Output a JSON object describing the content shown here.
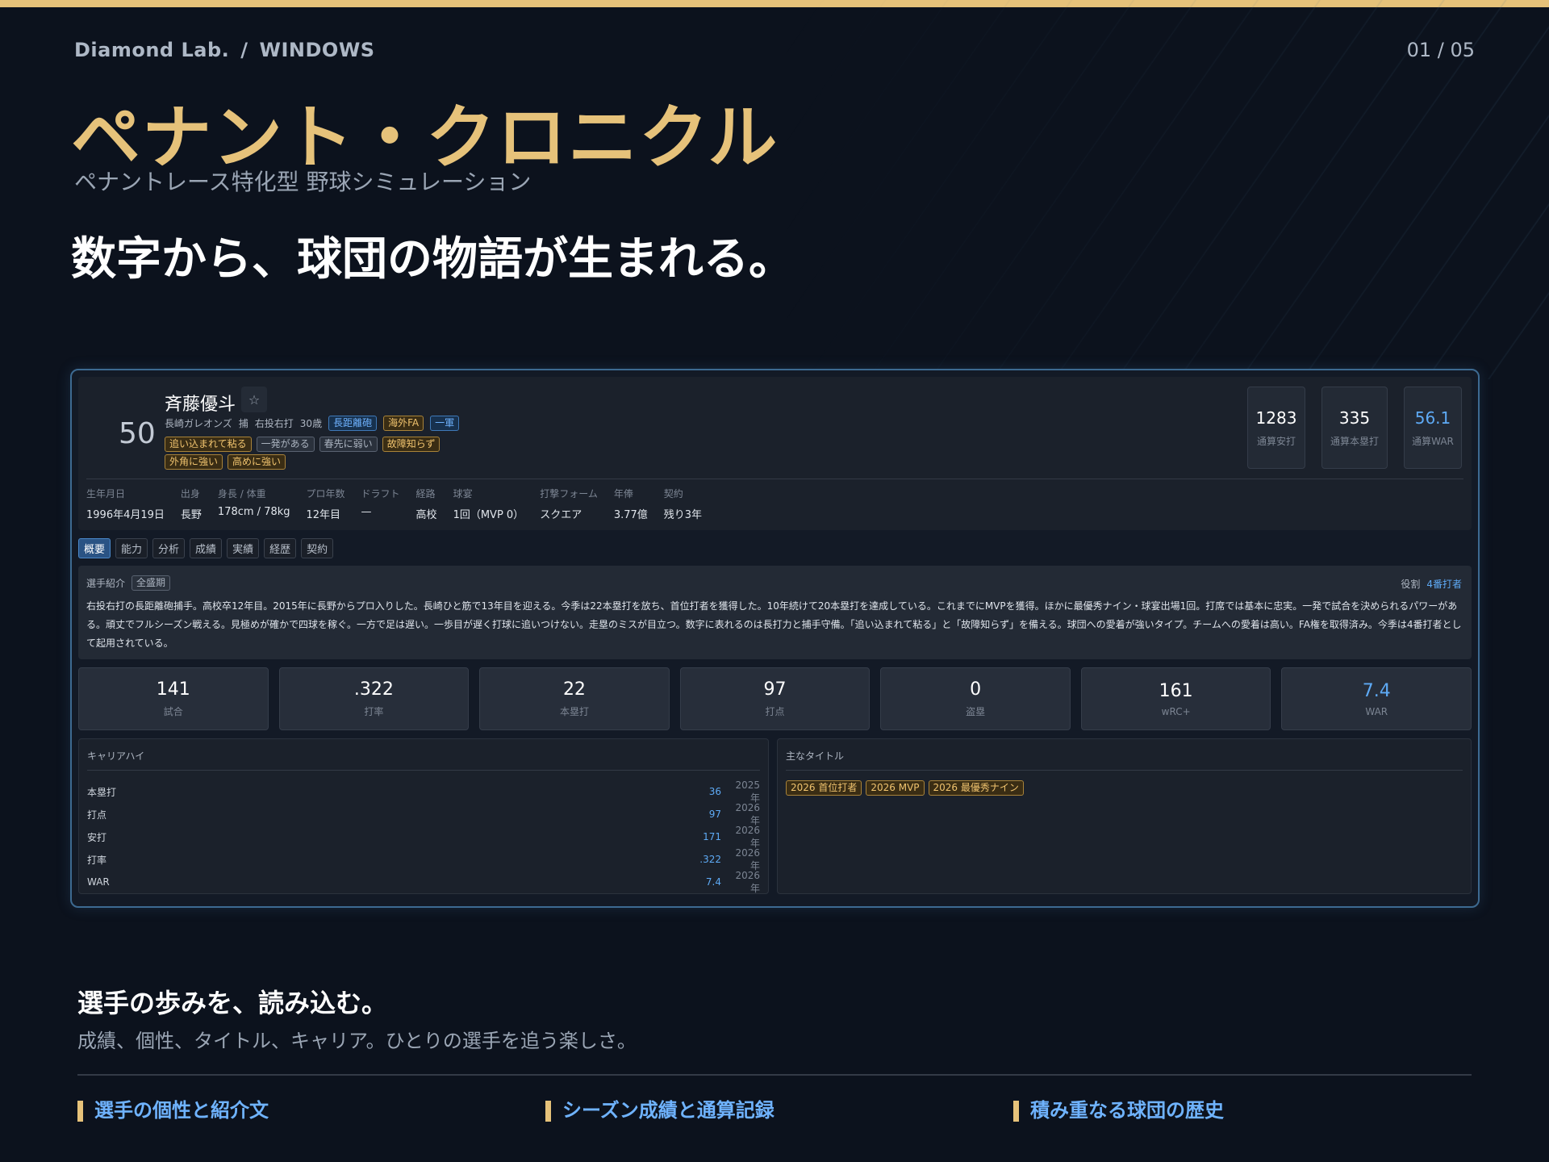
{
  "header": {
    "brand": "Diamond Lab.",
    "separator": "/",
    "section": "WINDOWS",
    "page": "01 / 05"
  },
  "hero": {
    "title": "ペナント・クロニクル",
    "subtitle": "ペナントレース特化型 野球シミュレーション",
    "tagline": "数字から、球団の物語が生まれる。"
  },
  "player": {
    "number": "50",
    "name": "斉藤優斗",
    "fav_icon": "star-outline-icon",
    "team": "長崎ガレオンズ",
    "position": "捕",
    "handed": "右投右打",
    "age": "30歳",
    "badges": [
      "長距離砲",
      "海外FA",
      "一軍"
    ],
    "traits_row1": [
      "追い込まれて粘る",
      "一発がある",
      "春先に弱い",
      "故障知らず"
    ],
    "traits_row2": [
      "外角に強い",
      "高めに強い"
    ],
    "highlights": [
      {
        "value": "1283",
        "label": "通算安打"
      },
      {
        "value": "335",
        "label": "通算本塁打"
      },
      {
        "value": "56.1",
        "label": "通算WAR"
      }
    ],
    "info": [
      {
        "label": "生年月日",
        "value": "1996年4月19日"
      },
      {
        "label": "出身",
        "value": "長野"
      },
      {
        "label": "身長 / 体重",
        "value": "178cm / 78kg"
      },
      {
        "label": "プロ年数",
        "value": "12年目"
      },
      {
        "label": "ドラフト",
        "value": "—"
      },
      {
        "label": "経路",
        "value": "高校"
      },
      {
        "label": "球宴",
        "value": "1回（MVP 0）"
      },
      {
        "label": "打撃フォーム",
        "value": "スクエア"
      },
      {
        "label": "年俸",
        "value": "3.77億"
      },
      {
        "label": "契約",
        "value": "残り3年"
      }
    ]
  },
  "tabs": [
    "概要",
    "能力",
    "分析",
    "成績",
    "実績",
    "経歴",
    "契約"
  ],
  "intro": {
    "label": "選手紹介",
    "period": "全盛期",
    "role_label": "役割",
    "role_value": "4番打者",
    "text": "右投右打の長距離砲捕手。高校卒12年目。2015年に長野からプロ入りした。長崎ひと筋で13年目を迎える。今季は22本塁打を放ち、首位打者を獲得した。10年続けて20本塁打を達成している。これまでにMVPを獲得。ほかに最優秀ナイン・球宴出場1回。打席では基本に忠実。一発で試合を決められるパワーがある。頑丈でフルシーズン戦える。見極めが確かで四球を稼ぐ。一方で足は遅い。一歩目が遅く打球に追いつけない。走塁のミスが目立つ。数字に表れるのは長打力と捕手守備。「追い込まれて粘る」と「故障知らず」を備える。球団への愛着が強いタイプ。チームへの愛着は高い。FA権を取得済み。今季は4番打者として起用されている。"
  },
  "season_stats": [
    {
      "value": "141",
      "label": "試合"
    },
    {
      "value": ".322",
      "label": "打率"
    },
    {
      "value": "22",
      "label": "本塁打"
    },
    {
      "value": "97",
      "label": "打点"
    },
    {
      "value": "0",
      "label": "盗塁"
    },
    {
      "value": "161",
      "label": "wRC+"
    },
    {
      "value": "7.4",
      "label": "WAR"
    }
  ],
  "career_high": {
    "title": "キャリアハイ",
    "rows": [
      {
        "label": "本塁打",
        "value": "36",
        "year": "2025年"
      },
      {
        "label": "打点",
        "value": "97",
        "year": "2026年"
      },
      {
        "label": "安打",
        "value": "171",
        "year": "2026年"
      },
      {
        "label": "打率",
        "value": ".322",
        "year": "2026年"
      },
      {
        "label": "WAR",
        "value": "7.4",
        "year": "2026年"
      }
    ]
  },
  "titles": {
    "title": "主なタイトル",
    "items": [
      "2026 首位打者",
      "2026 MVP",
      "2026 最優秀ナイン"
    ]
  },
  "feature": {
    "title": "選手の歩みを、読み込む。",
    "subtitle": "成績、個性、タイトル、キャリア。ひとりの選手を追う楽しさ。",
    "items": [
      "選手の個性と紹介文",
      "シーズン成績と通算記録",
      "積み重なる球団の歴史"
    ]
  },
  "colors": {
    "accent_gold": "#e6c27a",
    "accent_blue": "#5eaaf5",
    "background": "#0c121d"
  }
}
